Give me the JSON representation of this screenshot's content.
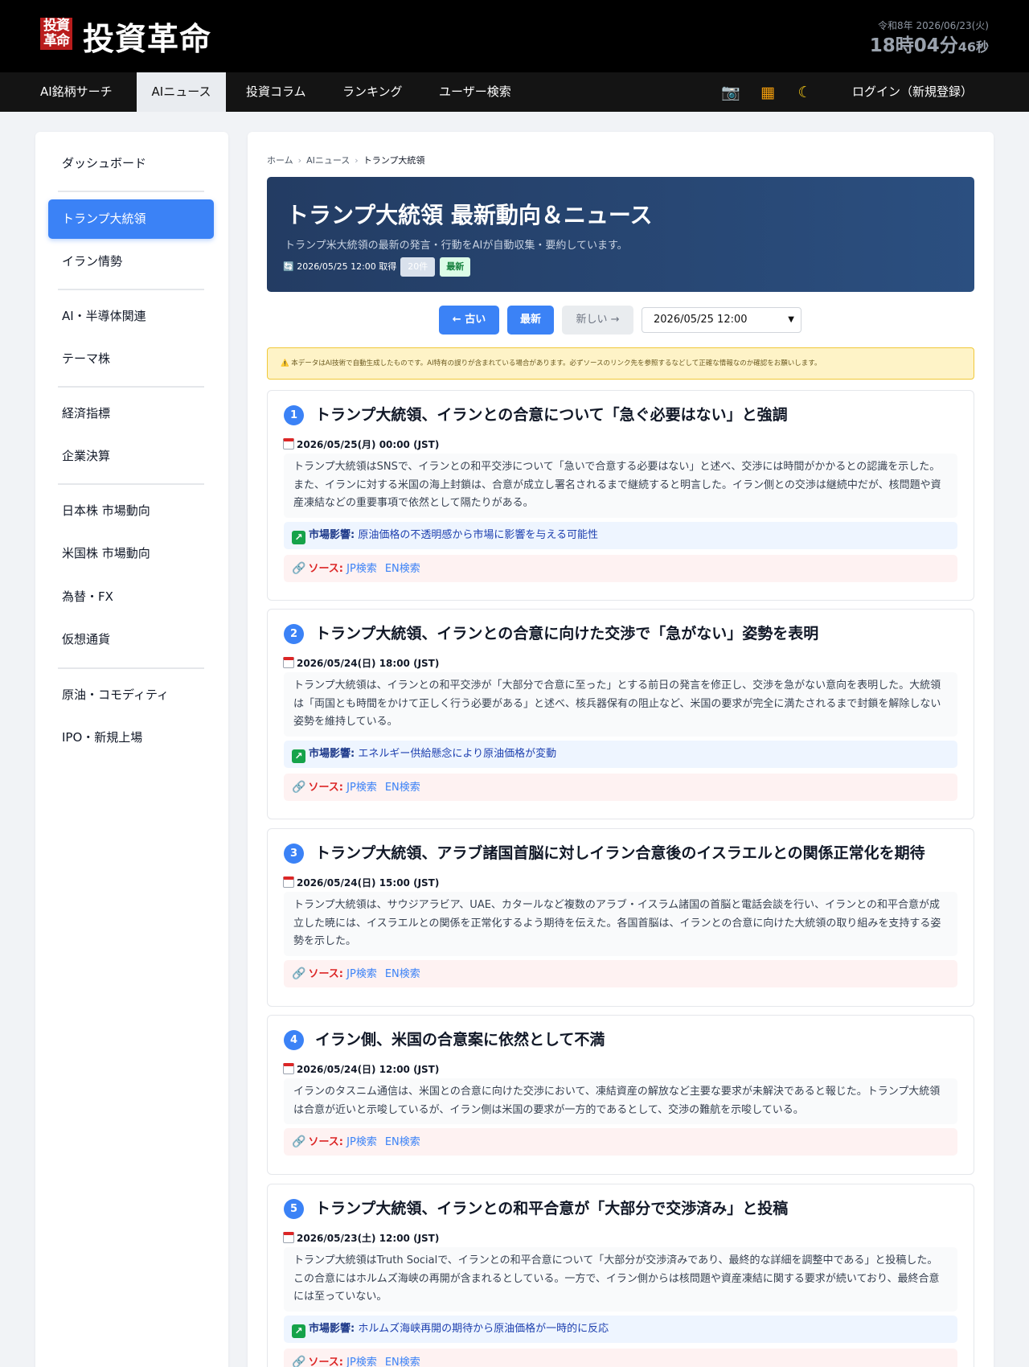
{
  "header": {
    "logo_mark_top": "投資",
    "logo_mark_bottom": "革命",
    "logo_text": "投資革命",
    "clock_date": "令和8年 2026/06/23(火)",
    "clock_time": "18時04分",
    "clock_seconds": "46秒"
  },
  "nav": {
    "items": [
      "AI銘柄サーチ",
      "AIニュース",
      "投資コラム",
      "ランキング",
      "ユーザー検索"
    ],
    "active": "AIニュース",
    "icons": [
      "camera-icon",
      "abacus-icon",
      "moon-icon"
    ],
    "icon_glyphs": [
      "📷",
      "▦",
      "☾"
    ],
    "login": "ログイン（新規登録）"
  },
  "sidebar": {
    "items": [
      {
        "label": "ダッシュボード"
      },
      {
        "label": "トランプ大統領",
        "active": true
      },
      {
        "label": "イラン情勢"
      },
      {
        "label": "AI・半導体関連"
      },
      {
        "label": "テーマ株"
      },
      {
        "label": "経済指標"
      },
      {
        "label": "企業決算"
      },
      {
        "label": "日本株 市場動向"
      },
      {
        "label": "米国株 市場動向"
      },
      {
        "label": "為替・FX"
      },
      {
        "label": "仮想通貨"
      },
      {
        "label": "原油・コモディティ"
      },
      {
        "label": "IPO・新規上場"
      }
    ]
  },
  "breadcrumb": {
    "home": "ホーム",
    "section": "AIニュース",
    "current": "トランプ大統領",
    "separator": "›"
  },
  "hero": {
    "title": "トランプ大統領 最新動向＆ニュース",
    "subtitle": "トランプ米大統領の最新の発言・行動をAIが自動収集・要約しています。",
    "fetched": "🔄 2026/05/25 12:00 取得",
    "count": "20件",
    "latest_badge": "最新"
  },
  "pager": {
    "older": "← 古い",
    "latest": "最新",
    "newer": "新しい →",
    "selected_date": "2026/05/25 12:00"
  },
  "notice": "⚠️ 本データはAI技術で自動生成したものです。AI特有の誤りが含まれている場合があります。必ずソースのリンク先を参照するなどして正確な情報なのか確認をお願いします。",
  "labels": {
    "impact": "市場影響:",
    "source": "ソース:",
    "jp_search": "JP検索",
    "en_search": "EN検索"
  },
  "news": [
    {
      "num": "1",
      "title": "トランプ大統領、イランとの合意について「急ぐ必要はない」と強調",
      "date": "2026/05/25(月) 00:00 (JST)",
      "summary": "トランプ大統領はSNSで、イランとの和平交渉について「急いで合意する必要はない」と述べ、交渉には時間がかかるとの認識を示した。また、イランに対する米国の海上封鎖は、合意が成立し署名されるまで継続すると明言した。イラン側との交渉は継続中だが、核問題や資産凍結などの重要事項で依然として隔たりがある。",
      "impact": "原油価格の不透明感から市場に影響を与える可能性"
    },
    {
      "num": "2",
      "title": "トランプ大統領、イランとの合意に向けた交渉で「急がない」姿勢を表明",
      "date": "2026/05/24(日) 18:00 (JST)",
      "summary": "トランプ大統領は、イランとの和平交渉が「大部分で合意に至った」とする前日の発言を修正し、交渉を急がない意向を表明した。大統領は「両国とも時間をかけて正しく行う必要がある」と述べ、核兵器保有の阻止など、米国の要求が完全に満たされるまで封鎖を解除しない姿勢を維持している。",
      "impact": "エネルギー供給懸念により原油価格が変動"
    },
    {
      "num": "3",
      "title": "トランプ大統領、アラブ諸国首脳に対しイラン合意後のイスラエルとの関係正常化を期待",
      "date": "2026/05/24(日) 15:00 (JST)",
      "summary": "トランプ大統領は、サウジアラビア、UAE、カタールなど複数のアラブ・イスラム諸国の首脳と電話会談を行い、イランとの和平合意が成立した暁には、イスラエルとの関係を正常化するよう期待を伝えた。各国首脳は、イランとの合意に向けた大統領の取り組みを支持する姿勢を示した。",
      "impact": ""
    },
    {
      "num": "4",
      "title": "イラン側、米国の合意案に依然として不満",
      "date": "2026/05/24(日) 12:00 (JST)",
      "summary": "イランのタスニム通信は、米国との合意に向けた交渉において、凍結資産の解放など主要な要求が未解決であると報じた。トランプ大統領は合意が近いと示唆しているが、イラン側は米国の要求が一方的であるとして、交渉の難航を示唆している。",
      "impact": ""
    },
    {
      "num": "5",
      "title": "トランプ大統領、イランとの和平合意が「大部分で交渉済み」と投稿",
      "date": "2026/05/23(土) 12:00 (JST)",
      "summary": "トランプ大統領はTruth Socialで、イランとの和平合意について「大部分が交渉済みであり、最終的な詳細を調整中である」と投稿した。この合意にはホルムズ海峡の再開が含まれるとしている。一方で、イラン側からは核問題や資産凍結に関する要求が続いており、最終合意には至っていない。",
      "impact": "ホルムズ海峡再開の期待から原油価格が一時的に反応"
    }
  ]
}
